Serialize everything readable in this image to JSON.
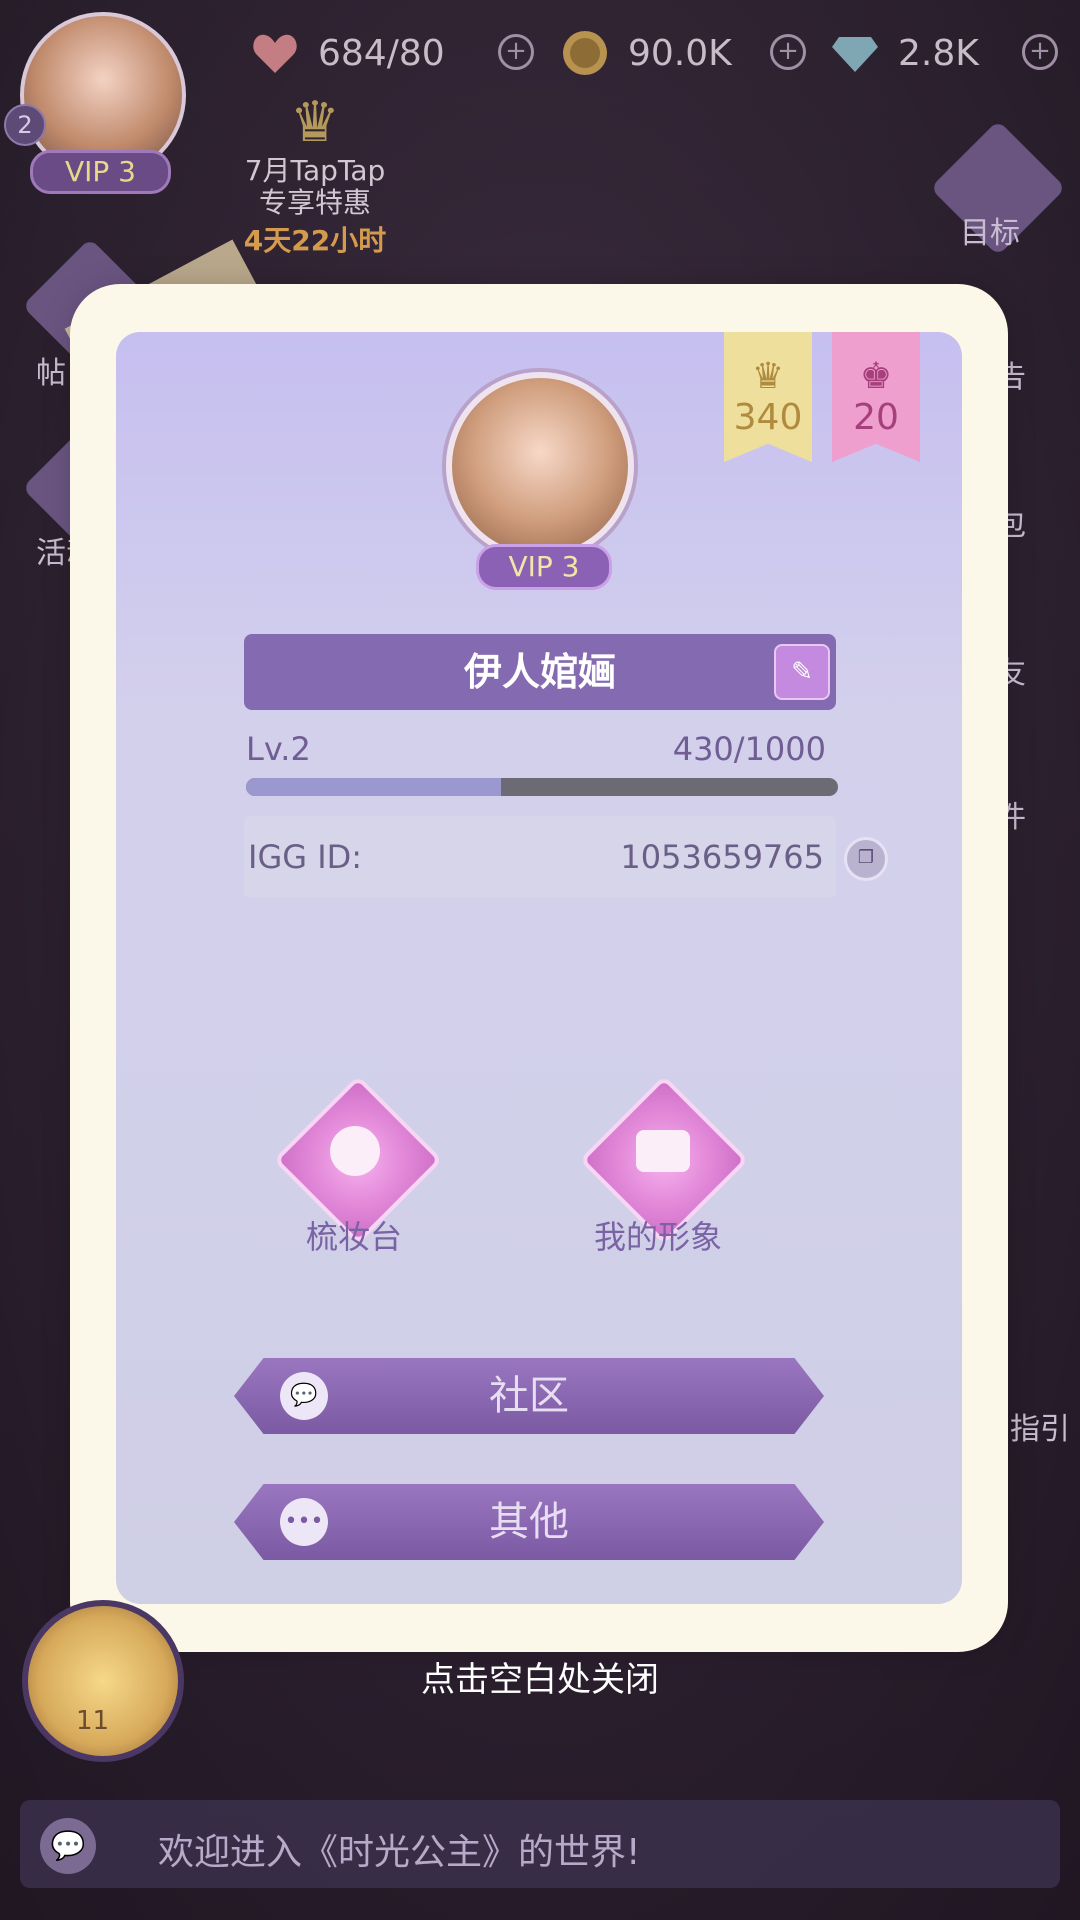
{
  "top_bar": {
    "hearts": {
      "icon": "heart-icon",
      "value": "684/80"
    },
    "coins": {
      "icon": "coin-icon",
      "value": "90.0K"
    },
    "diamonds": {
      "icon": "diamond-icon",
      "value": "2.8K"
    },
    "plus_symbol": "+"
  },
  "profile_small": {
    "vip_label": "VIP 3",
    "badge_count": "2"
  },
  "promo": {
    "line1": "7月TapTap",
    "line2": "专享特惠",
    "timer": "4天22小时"
  },
  "right_menu": {
    "target": "目标",
    "notice_partial": "告",
    "bag_partial": "包",
    "friends_partial": "友",
    "mail_partial": "件",
    "guide_partial": "的指引"
  },
  "left_menu": {
    "activity_partial": "活动",
    "help_partial": "帖"
  },
  "modal": {
    "ribbons": [
      {
        "icon": "crown-icon",
        "value": "340"
      },
      {
        "icon": "dress-icon",
        "value": "20"
      }
    ],
    "vip_label": "VIP 3",
    "player_name": "伊人婠婳",
    "level_label": "Lv.2",
    "exp_value": "430/1000",
    "exp_progress": 0.43,
    "igg_label": "IGG ID:",
    "igg_value": "1053659765",
    "features": [
      {
        "label": "梳妆台",
        "icon": "face-icon"
      },
      {
        "label": "我的形象",
        "icon": "camera-icon"
      }
    ],
    "buttons": [
      {
        "label": "社区",
        "icon": "chat-bubble-icon"
      },
      {
        "label": "其他",
        "icon": "more-icon"
      }
    ]
  },
  "close_hint": "点击空白处关闭",
  "trophy_level": "11",
  "welcome_text": "欢迎进入《时光公主》的世界!"
}
